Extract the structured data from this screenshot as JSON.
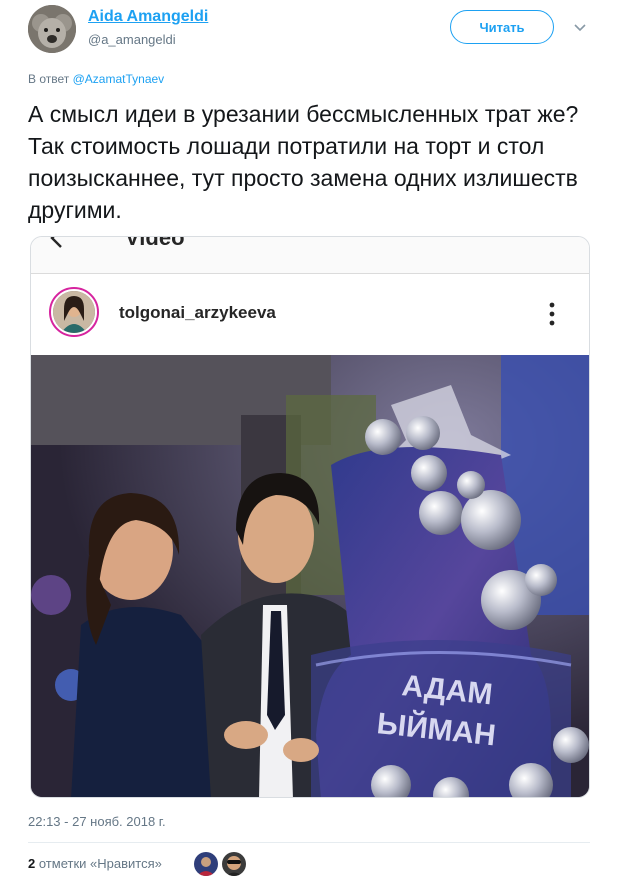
{
  "tweet": {
    "author_name": "Aida Amangeldi",
    "author_handle": "@a_amangeldi",
    "follow_label": "Читать",
    "reply_prefix": "В ответ",
    "reply_to": "@AzamatTynaev",
    "text": "А смысл идеи в урезании бессмысленных трат же? Так стоимость лошади потратили на торт и стол поизысканнее, тут просто замена одних излишеств другими.",
    "timestamp": "22:13 - 27 нояб. 2018 г.",
    "likes_count": "2",
    "likes_label": "отметки «Нравится»"
  },
  "embed": {
    "header_title": "Video",
    "username": "tolgonai_arzykeeva",
    "cake_text": [
      "АДАМ",
      "ЫЙМАН"
    ]
  },
  "colors": {
    "accent": "#1da1f2",
    "secondary_text": "#657786",
    "primary_text": "#14171a",
    "instagram_ring": "#d6249f"
  },
  "icons": {
    "chevron": "chevron-down-icon",
    "back": "back-arrow-icon",
    "more": "more-vertical-icon"
  }
}
